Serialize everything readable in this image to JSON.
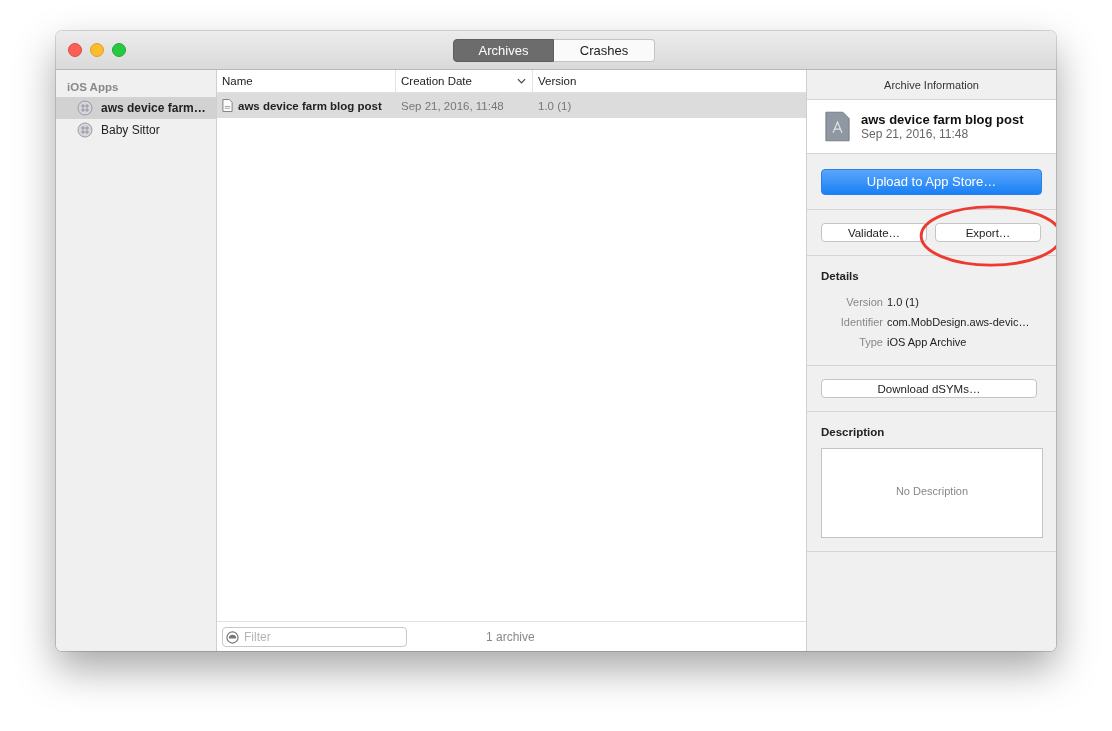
{
  "window": {
    "tabs": [
      {
        "label": "Archives",
        "selected": true
      },
      {
        "label": "Crashes",
        "selected": false
      }
    ]
  },
  "sidebar": {
    "heading": "iOS Apps",
    "items": [
      {
        "label": "aws device farm…",
        "selected": true
      },
      {
        "label": "Baby Sittor",
        "selected": false
      }
    ]
  },
  "table": {
    "columns": [
      "Name",
      "Creation Date",
      "Version"
    ],
    "rows": [
      {
        "name": "aws device farm blog post",
        "date": "Sep 21, 2016, 11:48",
        "version": "1.0 (1)",
        "selected": true
      }
    ]
  },
  "footer": {
    "filter": {
      "placeholder": "Filter"
    },
    "count": "1 archive"
  },
  "info": {
    "header": "Archive Information",
    "title": "aws device farm blog post",
    "date": "Sep 21, 2016, 11:48",
    "primary_button": "Upload to App Store…",
    "buttons": [
      "Validate…",
      "Export…"
    ],
    "details_heading": "Details",
    "details": [
      {
        "label": "Version",
        "value": "1.0 (1)"
      },
      {
        "label": "Identifier",
        "value": "com.MobDesign.aws-devic…"
      },
      {
        "label": "Type",
        "value": "iOS App Archive"
      }
    ],
    "dsyms_button": "Download dSYMs…",
    "description_heading": "Description",
    "description": {
      "placeholder": "No Description"
    }
  }
}
